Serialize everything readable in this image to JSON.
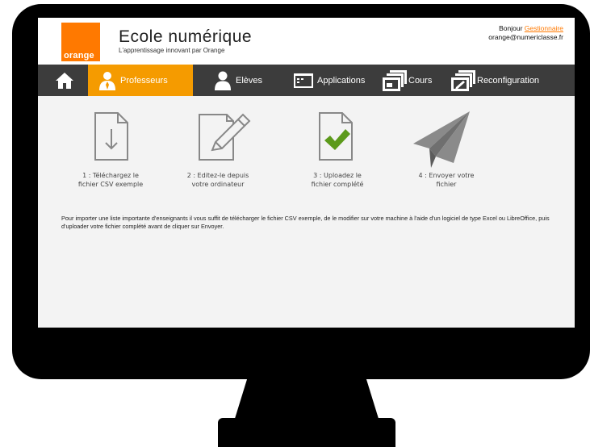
{
  "brand": {
    "logo_text": "orange",
    "title": "Ecole numérique",
    "subtitle": "L'apprentissage innovant par Orange",
    "accent_color": "#ff7900"
  },
  "user": {
    "greeting": "Bonjour",
    "name": "Gestionnaire",
    "email": "orange@numericlasse.fr"
  },
  "nav": {
    "home_icon": "home-icon",
    "items": [
      {
        "label": "Professeurs",
        "icon": "teacher-icon",
        "active": true
      },
      {
        "label": "Elèves",
        "icon": "student-icon",
        "active": false
      },
      {
        "label": "Applications",
        "icon": "applications-icon",
        "active": false
      },
      {
        "label": "Cours",
        "icon": "courses-icon",
        "active": false
      },
      {
        "label": "Reconfiguration",
        "icon": "reconfiguration-icon",
        "active": false
      }
    ],
    "active_color": "#f59b00",
    "bar_color": "#3c3c3c"
  },
  "steps": [
    {
      "line1": "1 : Téléchargez le",
      "line2": "fichier CSV exemple",
      "icon": "download-file-icon"
    },
    {
      "line1": "2 : Editez-le depuis",
      "line2": "votre ordinateur",
      "icon": "edit-pencil-icon"
    },
    {
      "line1": "3 : Uploadez le",
      "line2": "fichier complété",
      "icon": "check-file-icon"
    },
    {
      "line1": "4 : Envoyer votre",
      "line2": "fichier",
      "icon": "send-paper-plane-icon"
    }
  ],
  "description": "Pour importer une liste importante d'enseignants il vous suffit de télécharger le fichier CSV exemple, de le modifier sur votre machine à l'aide d'un logiciel de type Excel ou LibreOffice, puis d'uploader votre fichier complété avant de cliquer sur Envoyer."
}
